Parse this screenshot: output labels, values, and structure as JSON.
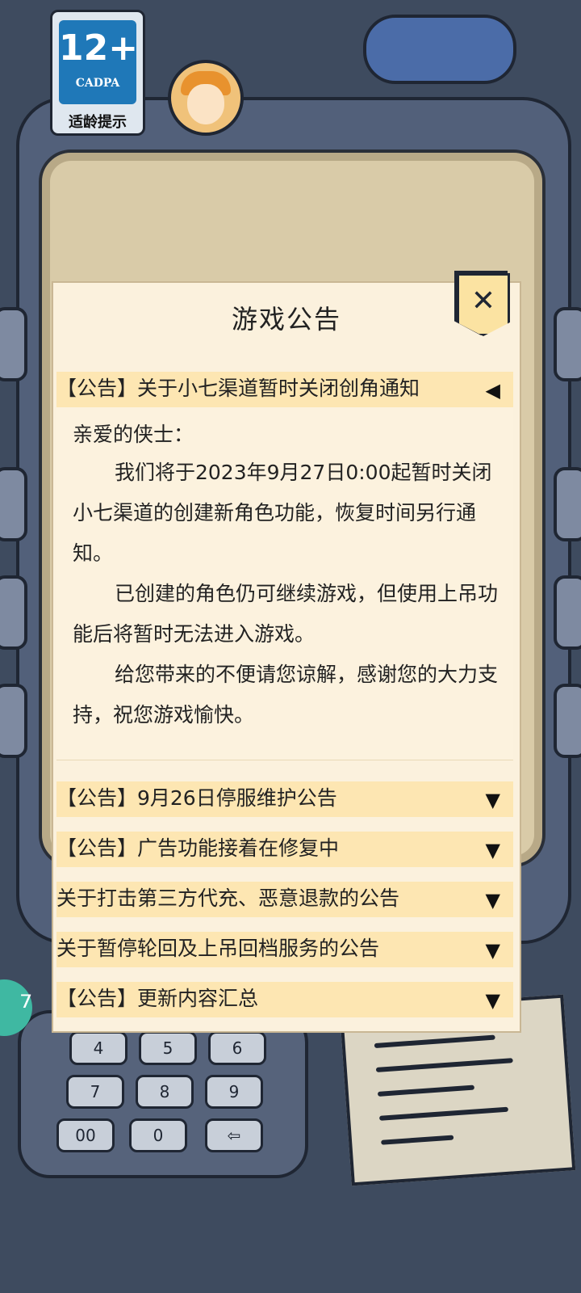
{
  "rating": {
    "age": "12+",
    "org": "CADPA",
    "caption": "适龄提示"
  },
  "keypad": {
    "keys": [
      "4",
      "5",
      "6",
      "7",
      "8",
      "9",
      "00",
      "0",
      "⇦"
    ]
  },
  "dialog": {
    "title": "游戏公告",
    "close_icon": "close-x-icon",
    "notices": [
      {
        "title": "【公告】关于小七渠道暂时关闭创角通知",
        "expanded": true,
        "greeting": "亲爱的侠士：",
        "paragraphs": [
          "我们将于2023年9月27日0:00起暂时关闭小七渠道的创建新角色功能，恢复时间另行通知。",
          "已创建的角色仍可继续游戏，但使用上吊功能后将暂时无法进入游戏。",
          "给您带来的不便请您谅解，感谢您的大力支持，祝您游戏愉快。"
        ]
      },
      {
        "title": "【公告】9月26日停服维护公告",
        "expanded": false
      },
      {
        "title": "【公告】广告功能接着在修复中",
        "expanded": false
      },
      {
        "title": "关于打击第三方代充、恶意退款的公告",
        "expanded": false
      },
      {
        "title": "关于暂停轮回及上吊回档服务的公告",
        "expanded": false
      },
      {
        "title": "【公告】更新内容汇总",
        "expanded": false
      }
    ],
    "arrow_expanded": "◀",
    "arrow_collapsed": "▼"
  },
  "colors": {
    "dialog_bg": "#fbf1dd",
    "header_bg": "#fde6b2",
    "background": "#3e4b5f",
    "badge_blue": "#1f78b8"
  }
}
